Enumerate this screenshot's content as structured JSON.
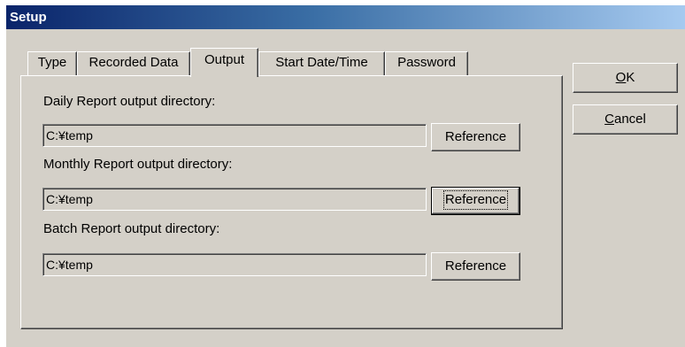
{
  "window": {
    "title": "Setup"
  },
  "tabs": [
    {
      "label": "Type"
    },
    {
      "label": "Recorded Data"
    },
    {
      "label": "Output"
    },
    {
      "label": "Start Date/Time"
    },
    {
      "label": "Password"
    }
  ],
  "active_tab": "Output",
  "output": {
    "daily": {
      "label": "Daily Report output directory:",
      "value": "C:¥temp",
      "button": "Reference"
    },
    "monthly": {
      "label": "Monthly Report output directory:",
      "value": "C:¥temp",
      "button": "Reference"
    },
    "batch": {
      "label": "Batch Report output directory:",
      "value": "C:¥temp",
      "button": "Reference"
    }
  },
  "buttons": {
    "ok": {
      "first": "O",
      "rest": "K"
    },
    "cancel": {
      "first": "C",
      "rest": "ancel"
    }
  }
}
